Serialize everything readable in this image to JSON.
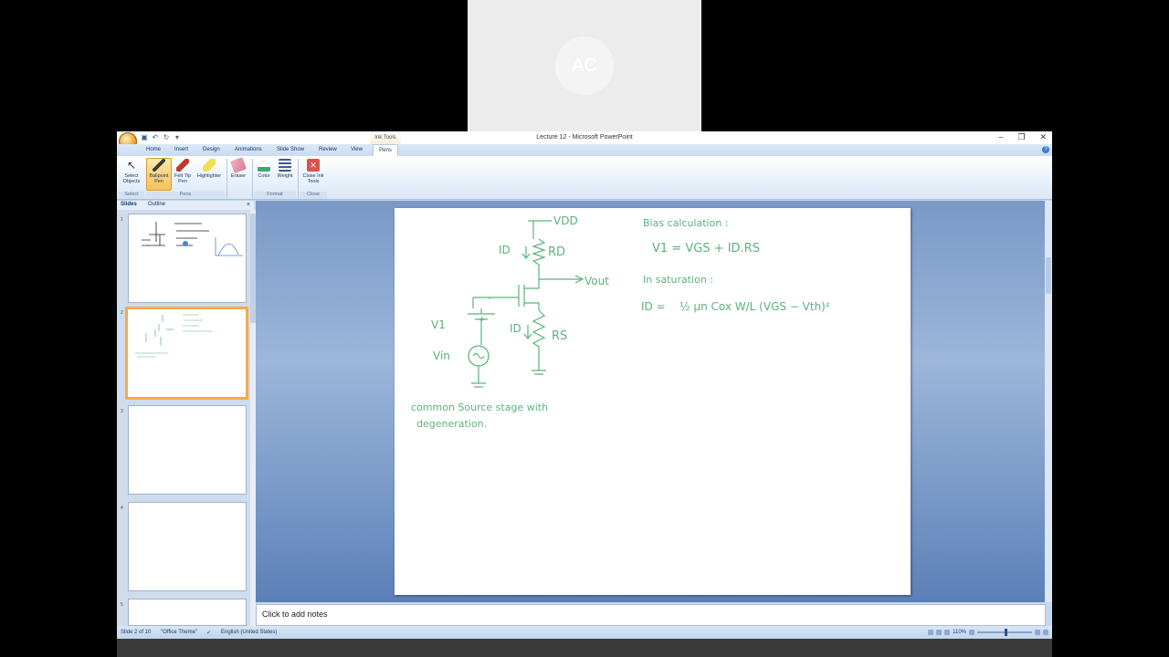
{
  "webcam": {
    "initials": "AC"
  },
  "window": {
    "title": "Lecture 12 - Microsoft PowerPoint",
    "context_tab": "Ink Tools"
  },
  "tabs": [
    "Home",
    "Insert",
    "Design",
    "Animations",
    "Slide Show",
    "Review",
    "View"
  ],
  "active_tab": "Pens",
  "ribbon": {
    "select_objects": "Select Objects",
    "ballpoint_pen": "Ballpoint Pen",
    "felt_tip_pen": "Felt Tip Pen",
    "highlighter": "Highlighter",
    "eraser": "Eraser",
    "color": "Color",
    "weight": "Weight",
    "close_ink_tools": "Close Ink Tools",
    "groups": {
      "select": "Select",
      "pens": "Pens",
      "format": "Format",
      "close": "Close"
    }
  },
  "pane": {
    "slides_tab": "Slides",
    "outline_tab": "Outline",
    "thumb_numbers": [
      "1",
      "2",
      "3",
      "4",
      "5"
    ]
  },
  "slide": {
    "vdd": "VDD",
    "id_top": "ID",
    "rd": "RD",
    "vout": "Vout",
    "v1": "V1",
    "id_bottom": "ID",
    "rs": "RS",
    "vin": "Vin",
    "caption_line1": "common Source stage with",
    "caption_line2": "degeneration.",
    "bias_title": "Bias calculation :",
    "bias_eq": "V1 = VGS + ID.RS",
    "sat_title": "In saturation :",
    "sat_eq_lhs": "ID =",
    "sat_eq_rhs": "½ μn Cox W/L (VGS − Vth)²"
  },
  "notes": {
    "placeholder": "Click to add notes"
  },
  "status": {
    "slide_info": "Slide 2 of 10",
    "theme": "\"Office Theme\"",
    "language": "English (United States)",
    "zoom": "110%"
  },
  "colors": {
    "ink": "#5bb27c",
    "selection": "#f6a94a"
  }
}
